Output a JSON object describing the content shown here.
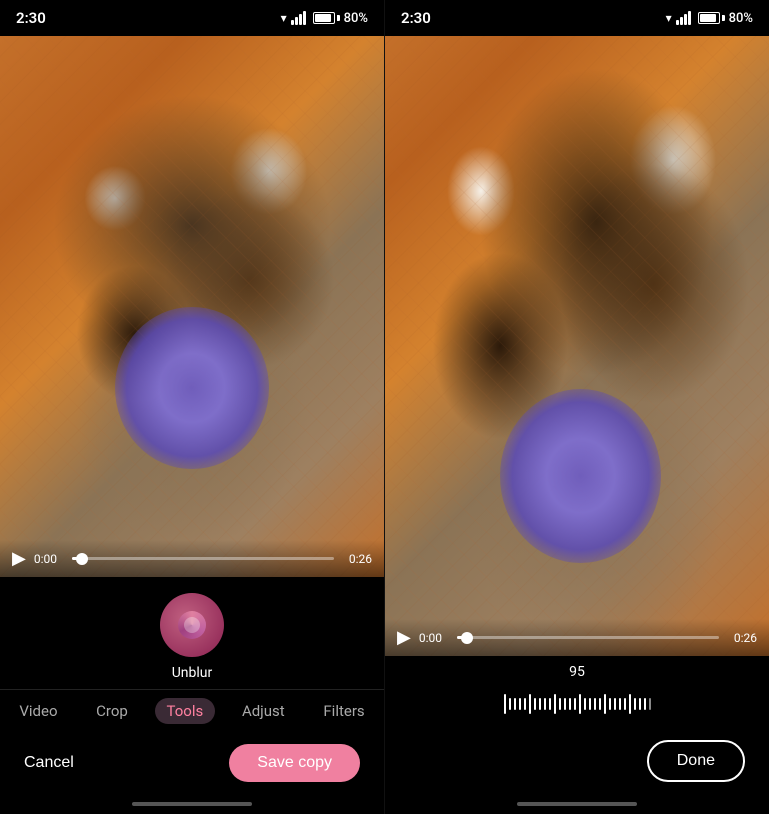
{
  "left_panel": {
    "status": {
      "time": "2:30",
      "battery": "80%"
    },
    "video": {
      "current_time": "0:00",
      "duration": "0:26",
      "progress_pct": 4
    },
    "tools": {
      "active_tool_label": "Unblur"
    },
    "tabs": [
      {
        "id": "video",
        "label": "Video",
        "active": false
      },
      {
        "id": "crop",
        "label": "Crop",
        "active": false
      },
      {
        "id": "tools",
        "label": "Tools",
        "active": true
      },
      {
        "id": "adjust",
        "label": "Adjust",
        "active": false
      },
      {
        "id": "filters",
        "label": "Filters",
        "active": false
      }
    ],
    "actions": {
      "cancel_label": "Cancel",
      "save_label": "Save copy"
    }
  },
  "right_panel": {
    "status": {
      "time": "2:30",
      "battery": "80%"
    },
    "video": {
      "current_time": "0:00",
      "duration": "0:26",
      "progress_pct": 4
    },
    "slider": {
      "value": 95,
      "min": 0,
      "max": 100
    },
    "actions": {
      "done_label": "Done"
    }
  }
}
